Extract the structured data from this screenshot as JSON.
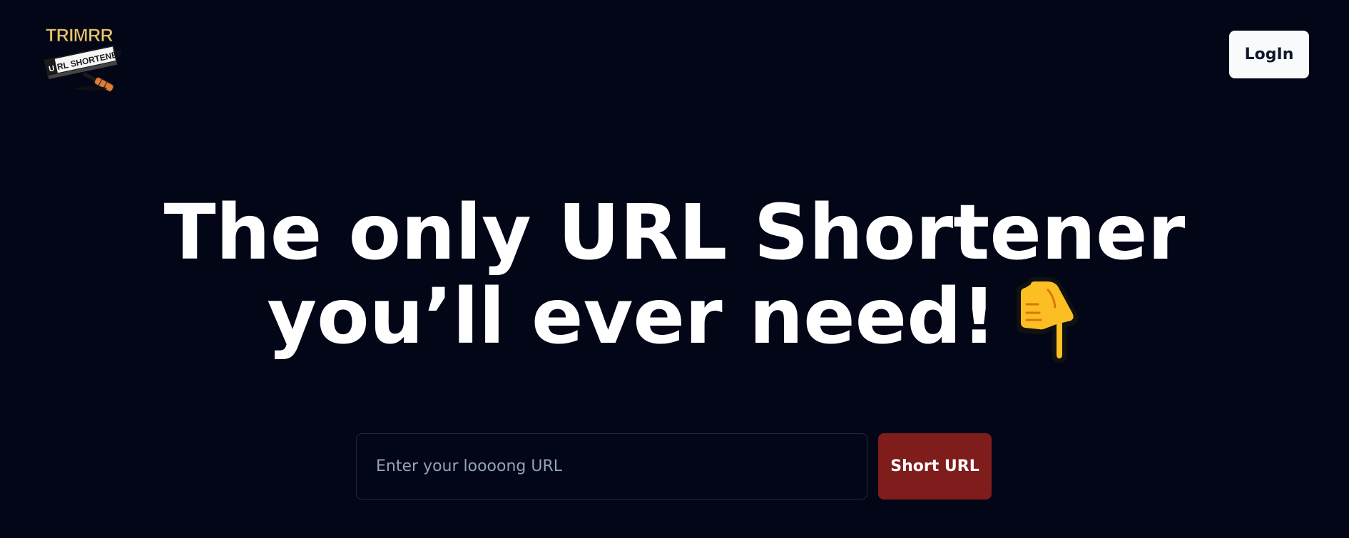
{
  "header": {
    "logo": {
      "name": "trimrr-logo",
      "text_top": "TRIMRR",
      "text_banner": "URL SHORTENER"
    },
    "login_label": "LogIn"
  },
  "hero": {
    "line1": "The only URL Shortener",
    "line2": "you’ll ever need!",
    "emoji_icon": "pointing-down-hand-icon"
  },
  "form": {
    "input_value": "",
    "input_placeholder": "Enter your loooong URL",
    "submit_label": "Short URL"
  },
  "colors": {
    "background": "#030617",
    "login_button_bg": "#f8fafc",
    "submit_button_bg": "#7f1d1d",
    "logo_accent": "#e9c46a",
    "hand": "#fbbf24"
  }
}
